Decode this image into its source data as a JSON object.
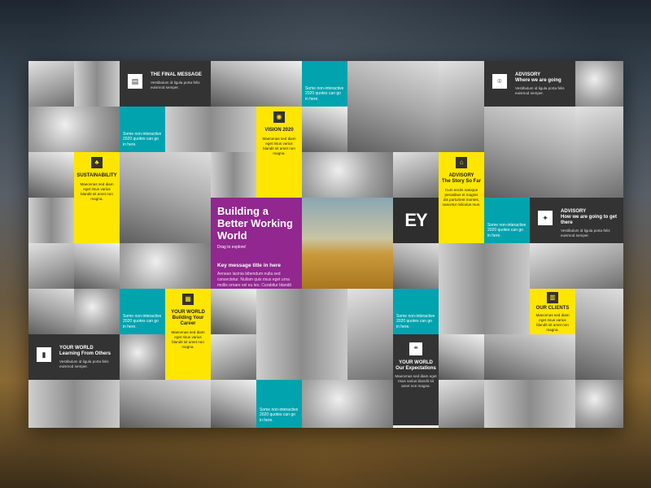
{
  "brand": {
    "logo": "EY",
    "accent_yellow": "#ffe600",
    "teal": "#00a3ae",
    "purple": "#91278f",
    "dark": "#333333"
  },
  "hero": {
    "title": "Building a Better Working World",
    "subtitle": "Drag to explore!",
    "key_title": "Key message title in here",
    "key_body": "Aenean lacinia bibendum nulla sed consectetur. Nullam quis risus eget urna mollis ornare vel eu leo. Curabitur blandit tempus porttitor. Donec sed odio dui."
  },
  "teal_tiles": [
    {
      "text": "Some non-interactive 2020 quotes can go in here."
    },
    {
      "text": "Some non-interactive 2020 quotes can go in here."
    },
    {
      "text": "Some non-interactive 2020 quotes can go in here."
    },
    {
      "text": "Some non-interactive 2020 quotes can go in here."
    },
    {
      "text": "Some non-interactive 2020 quotes can go in here."
    },
    {
      "text": "Some non-interactive 2020 quotes can go in here."
    }
  ],
  "dark_tiles": {
    "final_message": {
      "title": "THE FINAL MESSAGE",
      "body": "Vestibulum id ligula porta felis euismod semper.",
      "icon": "document-icon"
    },
    "advisory_1": {
      "title": "ADVISORY",
      "subtitle": "Where we are going",
      "body": "Vestibulum id ligula porta felis euismod semper.",
      "icon": "location-pin-icon"
    },
    "advisory_2": {
      "title": "ADVISORY",
      "subtitle": "How we are going to get there",
      "body": "Vestibulum id ligula porta felis euismod semper.",
      "icon": "compass-icon"
    },
    "your_world_1": {
      "title": "YOUR WORLD",
      "subtitle": "Learning From Others",
      "body": "Vestibulum id ligula porta felis euismod semper.",
      "icon": "book-icon"
    },
    "your_world_2": {
      "title": "YOUR WORLD",
      "subtitle": "Our Expectations",
      "body": "Maecenas sed diam eget risus varius blandit sit amet non magna.",
      "icon": "speech-bubble-icon"
    }
  },
  "yellow_tiles": {
    "vision": {
      "title": "VISION 2020",
      "body": "Maecenas sed diam eget risus varius blandit sit amet non magna.",
      "icon": "eye-icon"
    },
    "sustainability": {
      "title": "SUSTAINABILITY",
      "body": "Maecenas sed diam eget risus varius blandit sit amet non magna.",
      "icon": "plant-icon"
    },
    "advisory": {
      "title": "ADVISORY",
      "subtitle": "The Story So Far",
      "body": "Cum sociis natoque penatibus et magnis dis parturient montes, nascetur ridiculus mus.",
      "icon": "bank-icon"
    },
    "your_world": {
      "title": "YOUR WORLD",
      "subtitle": "Building Your Career",
      "body": "Maecenas sed diam eget risus varius blandit sit amet non magna.",
      "icon": "grid-icon"
    },
    "clients": {
      "title": "OUR CLIENTS",
      "body": "Maecenas sed diam eget risus varius blandit sit amet non magna.",
      "icon": "building-icon"
    }
  }
}
